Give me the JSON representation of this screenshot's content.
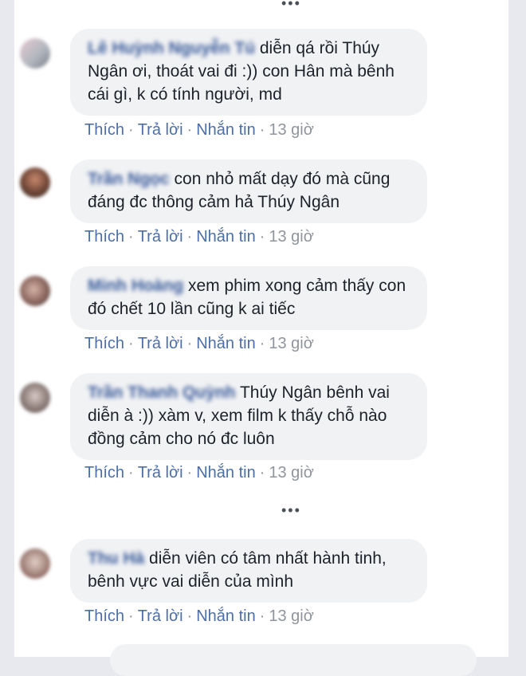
{
  "more_top": "•••",
  "more_mid": "•••",
  "comments": [
    {
      "author": "Lê Huỳnh Nguyễn Tú",
      "text": "diễn qá rồi Thúy Ngân ơi, thoát vai đi :)) con Hân mà bênh cái gì, k có tính người, md",
      "like": "Thích",
      "reply": "Trả lời",
      "message": "Nhắn tin",
      "time": "13 giờ"
    },
    {
      "author": "Trần Ngọc",
      "text": "con nhỏ mất dạy đó mà cũng đáng đc thông cảm hả Thúy Ngân",
      "like": "Thích",
      "reply": "Trả lời",
      "message": "Nhắn tin",
      "time": "13 giờ"
    },
    {
      "author": "Minh Hoàng",
      "text": "xem phim xong cảm thấy con đó chết 10 lần cũng k ai tiếc",
      "like": "Thích",
      "reply": "Trả lời",
      "message": "Nhắn tin",
      "time": "13 giờ"
    },
    {
      "author": "Trần Thanh Quỳnh",
      "text": "Thúy Ngân bênh vai diễn à :)) xàm v, xem film k thấy chỗ nào đồng cảm cho nó đc luôn",
      "like": "Thích",
      "reply": "Trả lời",
      "message": "Nhắn tin",
      "time": "13 giờ"
    },
    {
      "author": "Thu Hà",
      "text": "diễn viên có tâm nhất hành tinh, bênh vực vai diễn của mình",
      "like": "Thích",
      "reply": "Trả lời",
      "message": "Nhắn tin",
      "time": "13 giờ"
    }
  ]
}
